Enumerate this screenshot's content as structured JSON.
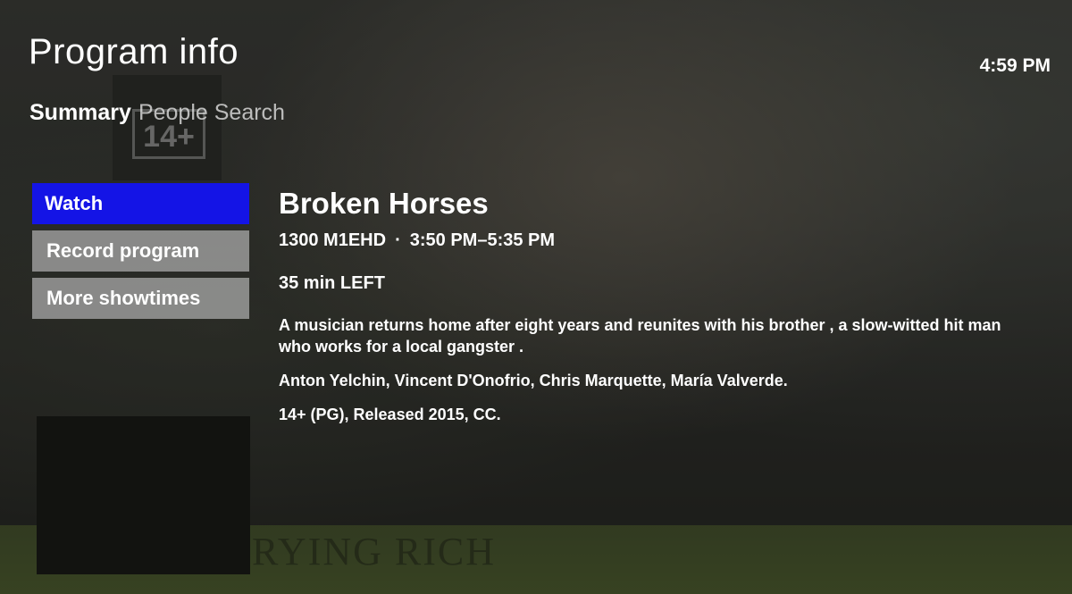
{
  "header": {
    "title": "Program info",
    "clock": "4:59 PM"
  },
  "tabs": [
    {
      "label": "Summary",
      "active": true
    },
    {
      "label": "People Search",
      "active": false
    }
  ],
  "menu": [
    {
      "label": "Watch",
      "selected": true
    },
    {
      "label": "Record program",
      "selected": false
    },
    {
      "label": "More showtimes",
      "selected": false
    }
  ],
  "program": {
    "title": "Broken Horses",
    "channel": "1300 M1EHD",
    "separator": "·",
    "time": "3:50 PM–5:35 PM",
    "remaining": "35 min LEFT",
    "description": "A musician returns home after eight years and reunites with his brother , a slow-witted hit man who works for a local gangster .",
    "cast": "Anton Yelchin, Vincent D'Onofrio, Chris Marquette, María Valverde.",
    "rating_info": "14+ (PG), Released 2015, CC."
  },
  "backdrop": {
    "rating_logo_text": "14+",
    "caption_text": "RYING RICH"
  },
  "colors": {
    "selected_menu": "#1414e6",
    "menu_item": "#afafaf",
    "background": "#353632"
  }
}
